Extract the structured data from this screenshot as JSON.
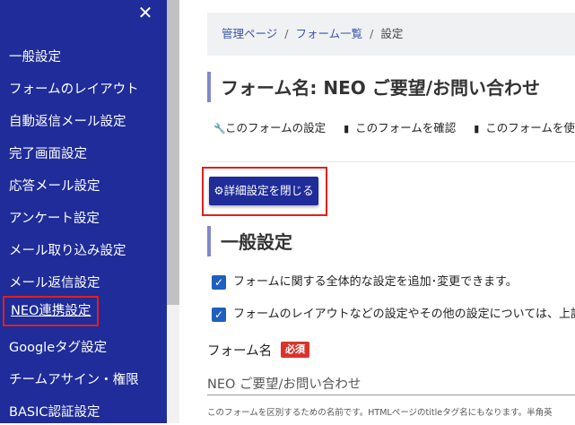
{
  "sidebar": {
    "close_glyph": "✕",
    "items": [
      {
        "label": "一般設定"
      },
      {
        "label": "フォームのレイアウト"
      },
      {
        "label": "自動返信メール設定"
      },
      {
        "label": "完了画面設定"
      },
      {
        "label": "応答メール設定"
      },
      {
        "label": "アンケート設定"
      },
      {
        "label": "メール取り込み設定"
      },
      {
        "label": "メール返信設定"
      },
      {
        "label": "NEO連携設定"
      },
      {
        "label": "Googleタグ設定"
      },
      {
        "label": "チームアサイン・権限"
      },
      {
        "label": "BASIC認証設定"
      }
    ],
    "active_index": 8
  },
  "breadcrumb": [
    "管理ページ",
    "フォーム一覧",
    "設定"
  ],
  "page_title": "フォーム名: NEO ご要望/お問い合わせ",
  "actions": [
    {
      "label": "このフォームの設定",
      "icon": "wrench-icon"
    },
    {
      "label": "このフォームを確認",
      "icon": "file-icon"
    },
    {
      "label": "このフォームを使う",
      "icon": "file-icon"
    }
  ],
  "close_detail_button": "詳細設定を閉じる",
  "section_title": "一般設定",
  "notes": [
    "フォームに関する全体的な設定を追加･変更できます。",
    "フォームのレイアウトなどの設定やその他の設定については、上記"
  ],
  "form_name_field": {
    "label": "フォーム名",
    "required_badge": "必須",
    "value": "NEO ご要望/お問い合わせ",
    "help": "このフォームを区別するための名前です。HTMLページのtitleタグ名にもなります。半角英"
  },
  "colors": {
    "sidebar": "#1f2c99",
    "highlight": "#e0201c",
    "button": "#1f2c99"
  }
}
